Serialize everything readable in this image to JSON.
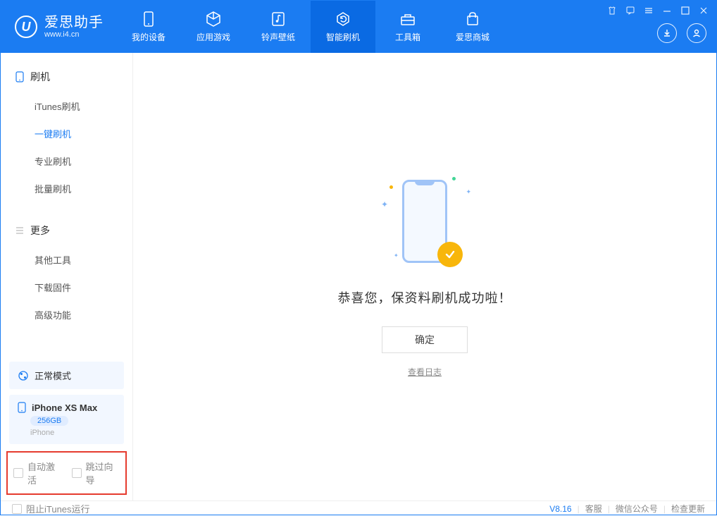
{
  "app": {
    "title": "爱思助手",
    "subtitle": "www.i4.cn"
  },
  "tabs": [
    {
      "label": "我的设备",
      "icon": "device"
    },
    {
      "label": "应用游戏",
      "icon": "cube"
    },
    {
      "label": "铃声壁纸",
      "icon": "music"
    },
    {
      "label": "智能刷机",
      "icon": "refresh",
      "active": true
    },
    {
      "label": "工具箱",
      "icon": "toolbox"
    },
    {
      "label": "爱思商城",
      "icon": "store"
    }
  ],
  "sidebar": {
    "section1": {
      "title": "刷机",
      "items": [
        {
          "label": "iTunes刷机"
        },
        {
          "label": "一键刷机",
          "active": true
        },
        {
          "label": "专业刷机"
        },
        {
          "label": "批量刷机"
        }
      ]
    },
    "section2": {
      "title": "更多",
      "items": [
        {
          "label": "其他工具"
        },
        {
          "label": "下载固件"
        },
        {
          "label": "高级功能"
        }
      ]
    },
    "mode": "正常模式",
    "device": {
      "name": "iPhone XS Max",
      "capacity": "256GB",
      "type": "iPhone"
    },
    "checkboxes": {
      "auto_activate": "自动激活",
      "skip_guide": "跳过向导"
    }
  },
  "main": {
    "success_msg": "恭喜您，保资料刷机成功啦！",
    "ok_button": "确定",
    "view_log": "查看日志"
  },
  "footer": {
    "block_itunes": "阻止iTunes运行",
    "version": "V8.16",
    "links": [
      "客服",
      "微信公众号",
      "检查更新"
    ]
  }
}
